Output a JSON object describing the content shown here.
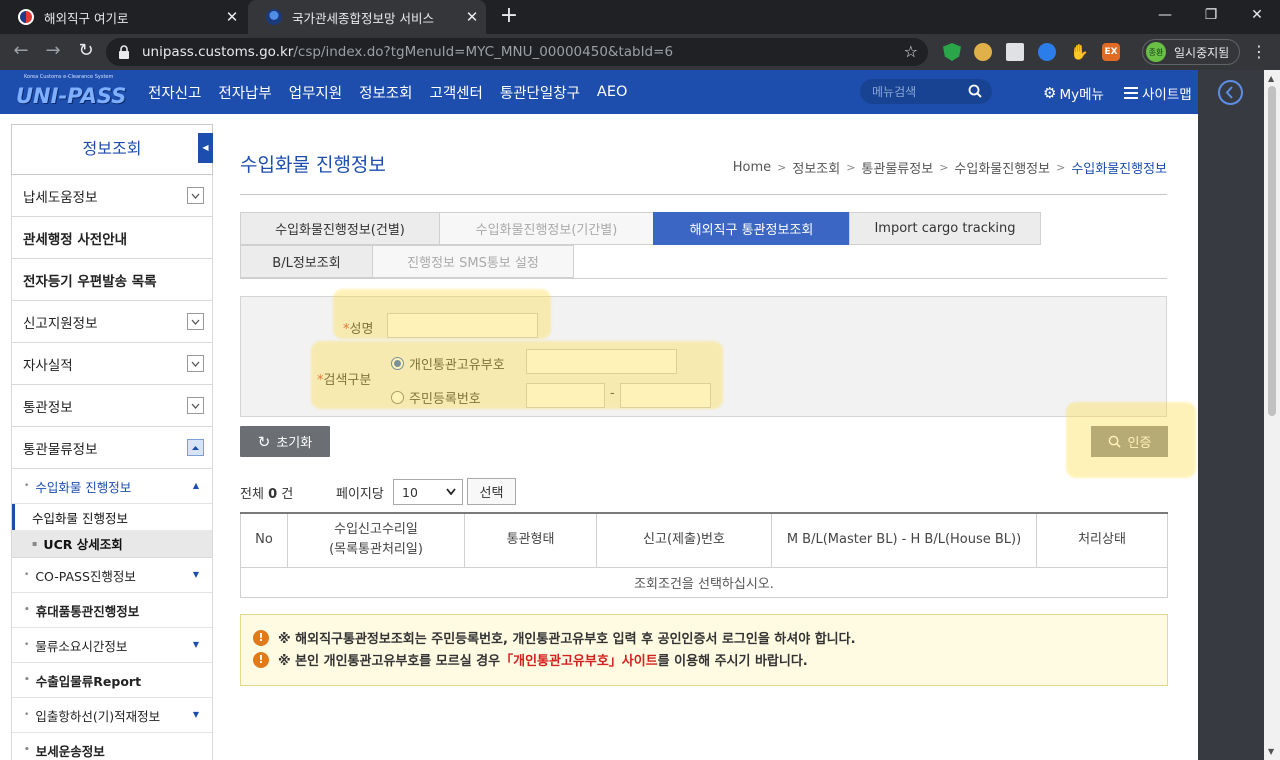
{
  "browser": {
    "tabs": [
      {
        "title": "해외직구 여기로",
        "active": false
      },
      {
        "title": "국가관세종합정보망 서비스",
        "active": true
      }
    ],
    "url_host": "unipass.customs.go.kr",
    "url_path": "/csp/index.do?tgMenuId=MYC_MNU_00000450&tabId=6",
    "profile_label": "일시중지됨",
    "profile_avatar": "종환",
    "extension_ex_label": "EX"
  },
  "site": {
    "logo_small": "Korea Customs e-Clearance System",
    "logo_main": "UNI-PASS",
    "gnb": [
      "전자신고",
      "전자납부",
      "업무지원",
      "정보조회",
      "고객센터",
      "통관단일창구",
      "AEO"
    ],
    "menu_search_placeholder": "메뉴검색",
    "mymenu_label": "My메뉴",
    "sitemap_label": "사이트맵",
    "brand_color": "#1d4eae"
  },
  "lnb": {
    "title": "정보조회",
    "items": [
      {
        "label": "납세도움정보",
        "expand": "down"
      },
      {
        "label": "관세행정 사전안내",
        "expand": null
      },
      {
        "label": "전자등기 우편발송 목록",
        "expand": null
      },
      {
        "label": "신고지원정보",
        "expand": "down"
      },
      {
        "label": "자사실적",
        "expand": "down"
      },
      {
        "label": "통관정보",
        "expand": "down"
      },
      {
        "label": "통관물류정보",
        "expand": "up"
      }
    ],
    "sub_items": [
      {
        "label": "수입화물 진행정보",
        "active": true
      },
      {
        "label": "수입화물 진행정보",
        "current": true
      },
      {
        "label": "UCR 상세조회"
      },
      {
        "label": "CO-PASS진행정보"
      },
      {
        "label": "휴대품통관진행정보"
      },
      {
        "label": "물류소요시간정보"
      },
      {
        "label": "수출입물류Report"
      },
      {
        "label": "입출항하선(기)적재정보"
      },
      {
        "label": "보세운송정보"
      }
    ]
  },
  "main": {
    "title": "수입화물 진행정보",
    "breadcrumb": [
      "Home",
      "정보조회",
      "통관물류정보",
      "수입화물진행정보",
      "수입화물진행정보"
    ],
    "tabs_row1": [
      {
        "label": "수입화물진행정보(건별)",
        "state": "normal"
      },
      {
        "label": "수입화물진행정보(기간별)",
        "state": "disabled"
      },
      {
        "label": "해외직구 통관정보조회",
        "state": "active"
      },
      {
        "label": "Import cargo tracking",
        "state": "normal"
      }
    ],
    "tabs_row2": [
      {
        "label": "B/L정보조회",
        "state": "normal"
      },
      {
        "label": "진행정보 SMS통보 설정",
        "state": "disabled"
      }
    ],
    "form": {
      "required_mark": "*",
      "name_label": "성명",
      "name_value": "",
      "search_type_label": "검색구분",
      "radio_customs_code": "개인통관고유부호",
      "radio_resident_no": "주민등록번호",
      "radio_selected": "customs_code",
      "customs_code_value": "",
      "resident_no_front": "",
      "resident_no_back": "",
      "dash": "-"
    },
    "reset_button": "초기화",
    "auth_button": "인증",
    "total_prefix": "전체",
    "total_count": "0",
    "total_suffix": "건",
    "per_page_label": "페이지당",
    "per_page_value": "10",
    "select_button": "선택",
    "table": {
      "headers": [
        "No",
        "수입신고수리일",
        "(목록통관처리일)",
        "통관형태",
        "신고(제출)번호",
        "M B/L(Master BL) - H B/L(House BL))",
        "처리상태"
      ],
      "empty_message": "조회조건을 선택하십시오."
    },
    "notice": {
      "line1": "※ 해외직구통관정보조회는 주민등록번호, 개인통관고유부호 입력 후 공인인증서 로그인을 하셔야 합니다.",
      "line2_prefix": "※ 본인 개인통관고유부호를 모르실 경우 ",
      "line2_link": "「개인통관고유부호」사이트",
      "line2_suffix": "를 이용해 주시기 바랍니다."
    }
  }
}
